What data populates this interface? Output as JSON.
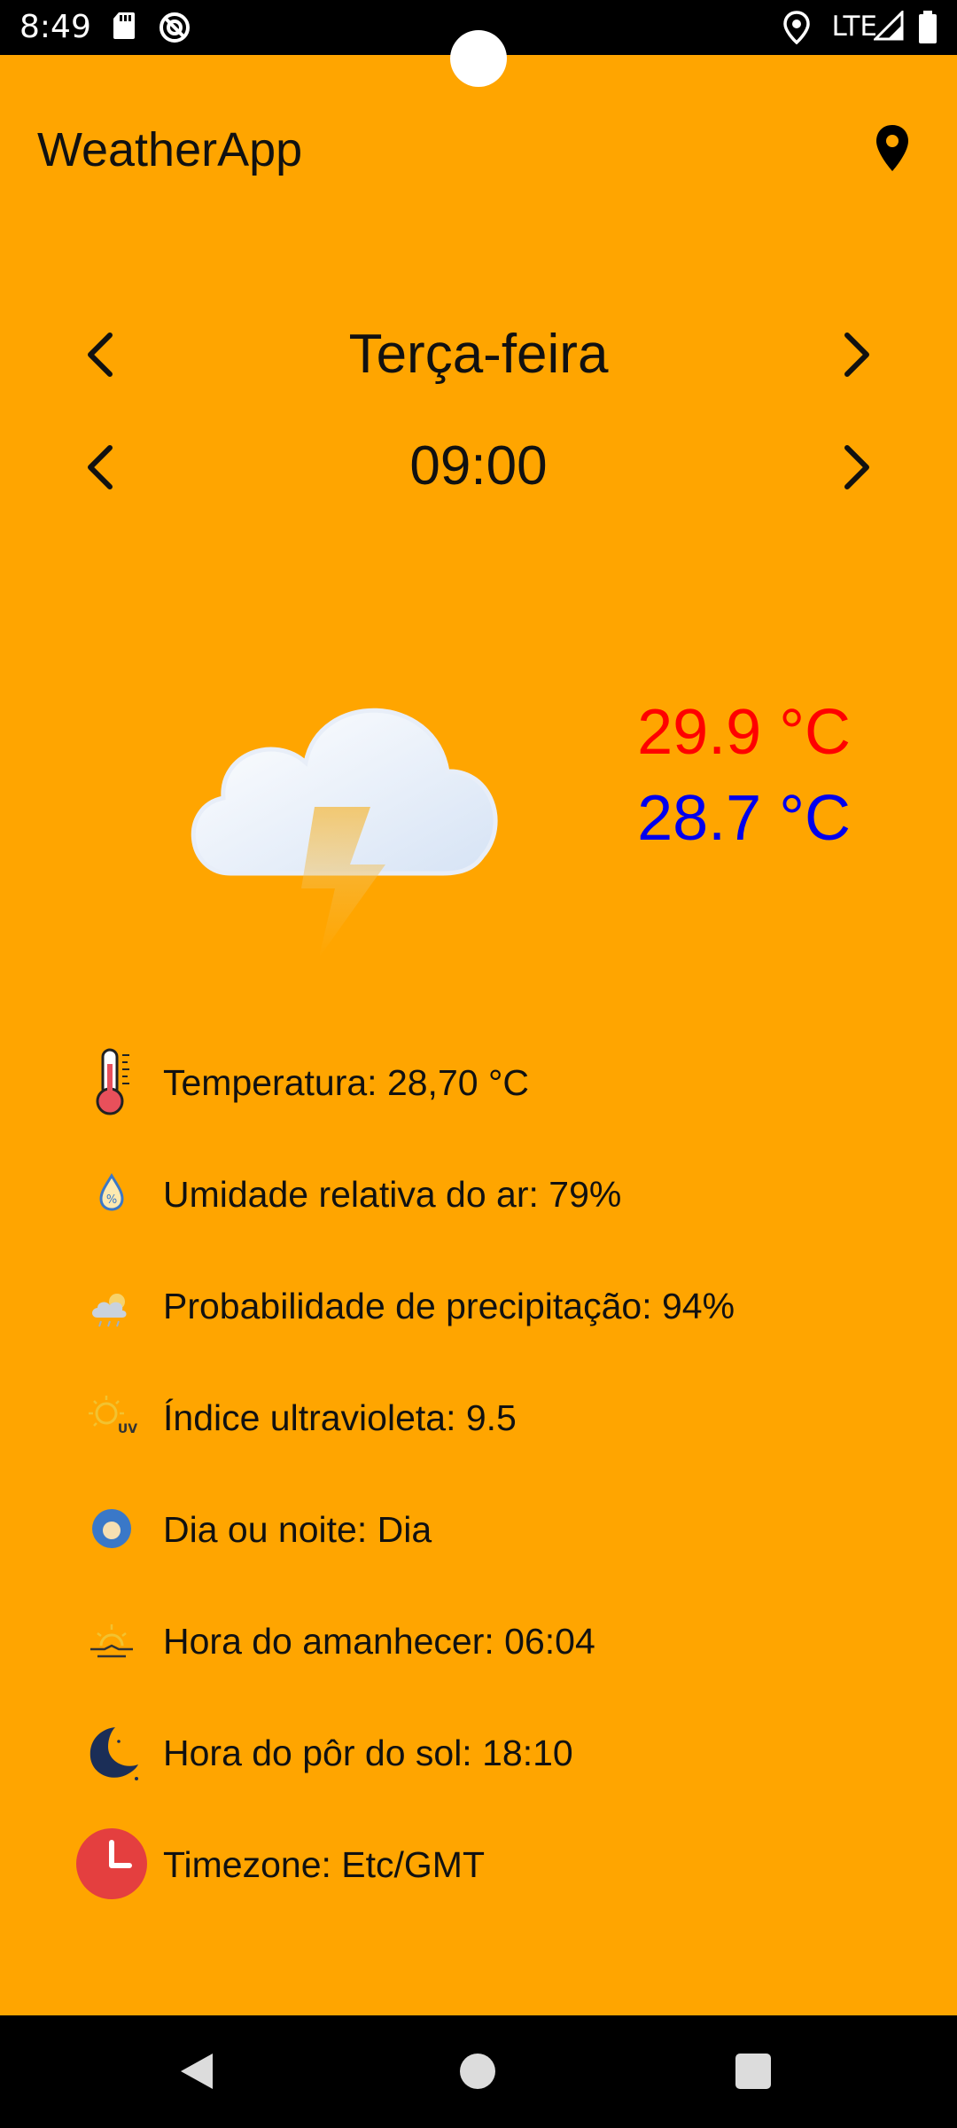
{
  "status_bar": {
    "time": "8:49",
    "network": "LTE",
    "icons": [
      "sd-card-icon",
      "do-not-disturb-icon",
      "location-icon",
      "signal-icon",
      "battery-icon"
    ]
  },
  "app_bar": {
    "title": "WeatherApp",
    "action_icon": "location-pin-icon"
  },
  "selectors": {
    "day": "Terça-feira",
    "time": "09:00"
  },
  "weather": {
    "icon": "cloud-thunder-icon",
    "temp_max": "29.9 °C",
    "temp_min": "28.7 °C",
    "colors": {
      "max": "#FF0000",
      "min": "#0000EE"
    }
  },
  "details": [
    {
      "icon": "thermometer-icon",
      "text": "Temperatura: 28,70 °C"
    },
    {
      "icon": "humidity-drop-icon",
      "text": "Umidade relativa do ar: 79%"
    },
    {
      "icon": "precipitation-cloud-icon",
      "text": "Probabilidade de precipitação: 94%"
    },
    {
      "icon": "uv-sun-icon",
      "text": "Índice ultravioleta: 9.5"
    },
    {
      "icon": "day-night-icon",
      "text": "Dia ou noite: Dia"
    },
    {
      "icon": "sunrise-icon",
      "text": "Hora do amanhecer: 06:04"
    },
    {
      "icon": "moon-icon",
      "text": "Hora do pôr do sol: 18:10"
    },
    {
      "icon": "clock-icon",
      "text": "Timezone: Etc/GMT"
    }
  ],
  "theme": {
    "background": "#FFA500"
  }
}
